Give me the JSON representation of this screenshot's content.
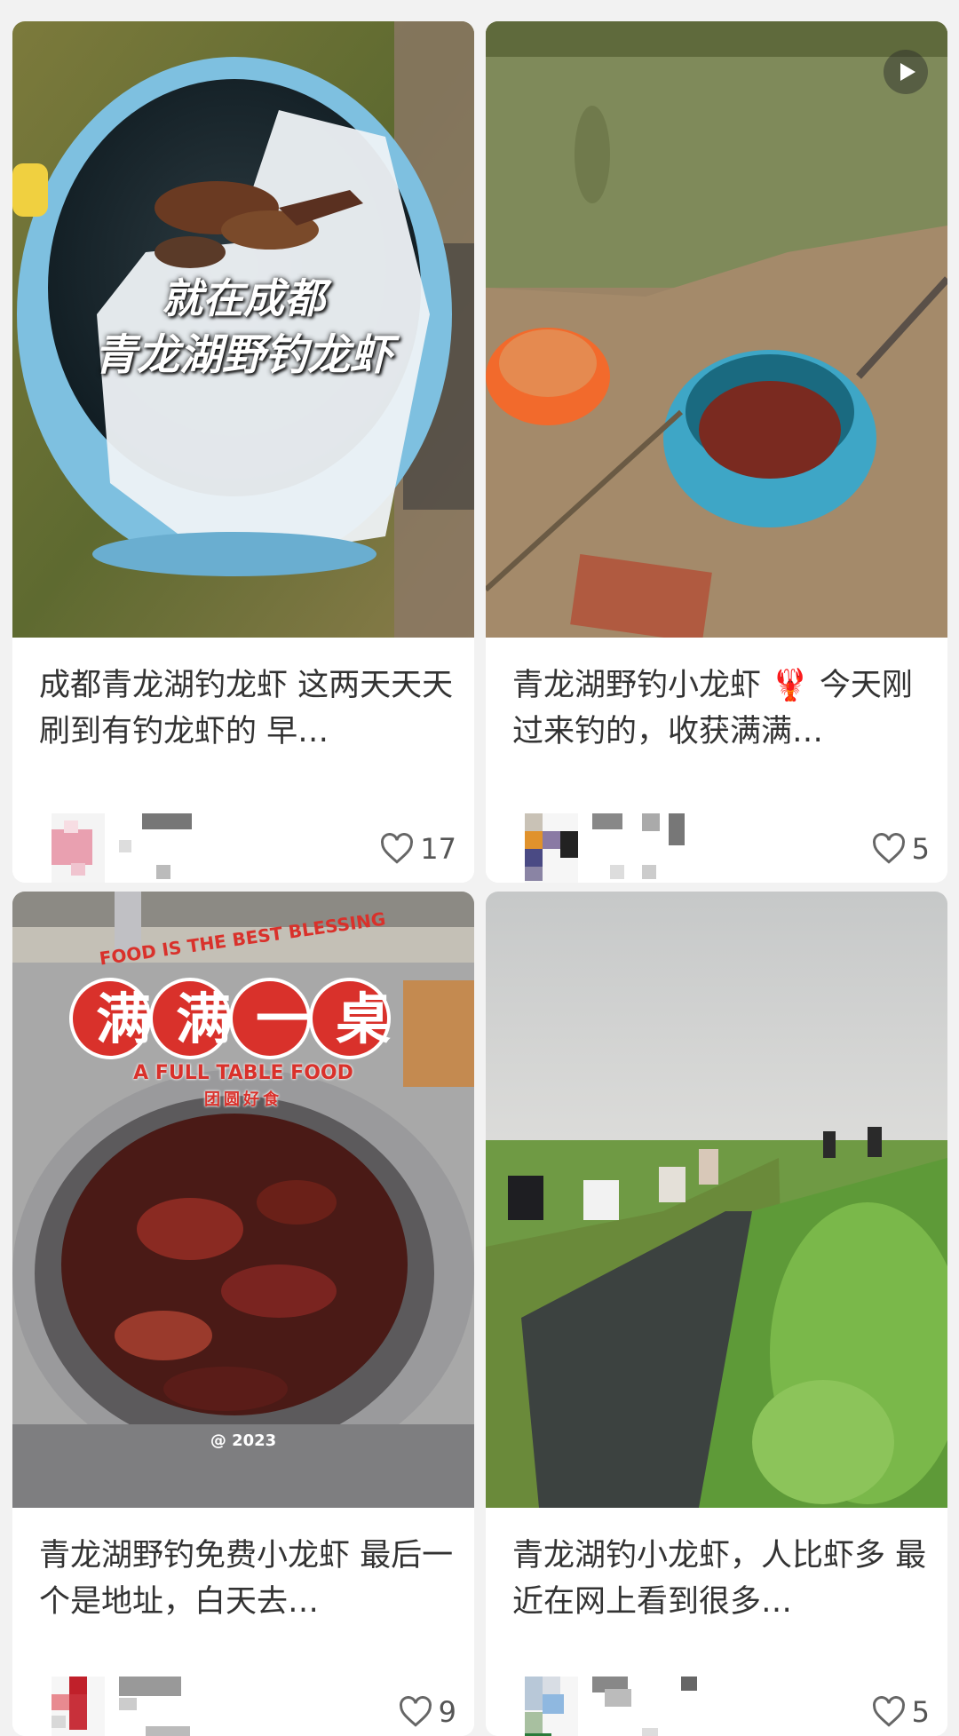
{
  "feed": {
    "cards": [
      {
        "overlay_line1": "就在成都",
        "overlay_line2": "青龙湖野钓龙虾",
        "title": "成都青龙湖钓龙虾 这两天天天刷到有钓龙虾的 早…",
        "likes": "17",
        "is_video": false
      },
      {
        "title": "青龙湖野钓小龙虾 🦞 今天刚过来钓的，收获满满…",
        "likes": "5",
        "is_video": true
      },
      {
        "sticker_arc": "FOOD IS THE BEST BLESSING",
        "sticker_main": "满满一桌",
        "sticker_sub": "A FULL TABLE FOOD",
        "sticker_cn": "团圆好食",
        "sticker_year": "@ 2023",
        "title": "青龙湖野钓免费小龙虾 最后一个是地址，白天去…",
        "likes": "9",
        "is_video": false
      },
      {
        "title": "青龙湖钓小龙虾，人比虾多 最近在网上看到很多…",
        "likes": "5",
        "is_video": false
      }
    ]
  },
  "icons": {
    "heart": "heart-icon",
    "play": "play-icon"
  },
  "colors": {
    "background": "#f2f2f2",
    "card": "#ffffff",
    "title_text": "#333333",
    "like_text": "#555555",
    "sticker_red": "#d9312b"
  }
}
